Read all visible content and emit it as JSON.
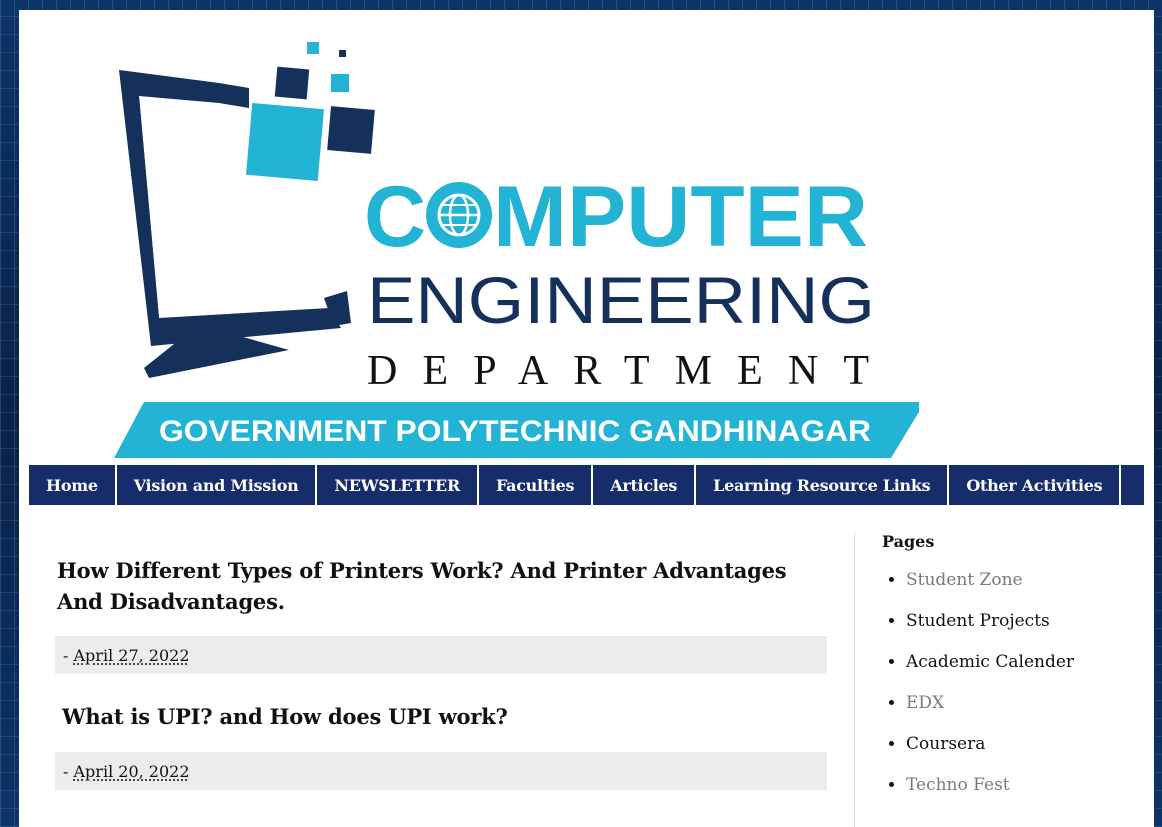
{
  "header": {
    "logo": {
      "line1": "COMPUTER",
      "line2": "ENGINEERING",
      "line3": "DEPARTMENT",
      "banner": "GOVERNMENT POLYTECHNIC GANDHINAGAR",
      "colors": {
        "cyan": "#23b3d4",
        "navy": "#16305c"
      }
    }
  },
  "nav": {
    "items": [
      {
        "label": "Home"
      },
      {
        "label": "Vision and Mission"
      },
      {
        "label": "NEWSLETTER"
      },
      {
        "label": "Faculties"
      },
      {
        "label": "Articles"
      },
      {
        "label": "Learning Resource Links"
      },
      {
        "label": "Other Activities"
      }
    ],
    "background": "#162c6b"
  },
  "posts": [
    {
      "title": "How Different Types of Printers Work? And Printer Advantages And Disadvantages.",
      "meta_prefix": "- ",
      "date": "April 27, 2022"
    },
    {
      "title": "What is UPI? and How does UPI work?",
      "meta_prefix": "- ",
      "date": "April 20, 2022"
    }
  ],
  "sidebar": {
    "heading": "Pages",
    "items": [
      {
        "label": "Student Zone",
        "style": "muted"
      },
      {
        "label": "Student Projects",
        "style": "normal"
      },
      {
        "label": "Academic Calender",
        "style": "normal"
      },
      {
        "label": "EDX",
        "style": "muted"
      },
      {
        "label": "Coursera",
        "style": "normal"
      },
      {
        "label": "Techno Fest",
        "style": "muted"
      }
    ]
  }
}
